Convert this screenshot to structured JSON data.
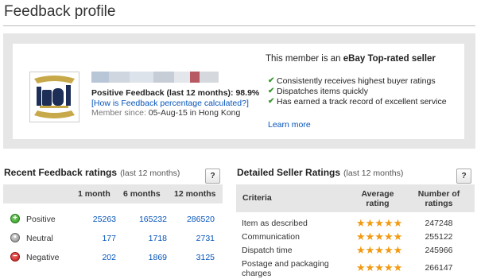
{
  "page": {
    "title": "Feedback profile"
  },
  "profile": {
    "positive_feedback": "Positive Feedback (last 12 months): 98.9%",
    "calc_link": "[How is Feedback percentage calculated?]",
    "member_since_label": "Member since:",
    "member_since_value": "05-Aug-15 in Hong Kong",
    "logo_icon": "no1-logo-icon"
  },
  "top_rated": {
    "prefix": "This member is an ",
    "highlight": "eBay Top-rated seller",
    "benefits": [
      "Consistently receives highest buyer ratings",
      "Dispatches items quickly",
      "Has earned a track record of excellent service"
    ],
    "learn_more": "Learn more",
    "check_color": "#3a9a2f"
  },
  "recent_feedback": {
    "title": "Recent Feedback ratings",
    "subtitle": "(last 12 months)",
    "help": "?",
    "columns": [
      "1 month",
      "6 months",
      "12 months"
    ],
    "rows": [
      {
        "label": "Positive",
        "icon": "positive-plus-icon",
        "values": [
          "25263",
          "165232",
          "286520"
        ]
      },
      {
        "label": "Neutral",
        "icon": "neutral-dot-icon",
        "values": [
          "177",
          "1718",
          "2731"
        ]
      },
      {
        "label": "Negative",
        "icon": "negative-minus-icon",
        "values": [
          "202",
          "1869",
          "3125"
        ]
      }
    ]
  },
  "detailed_ratings": {
    "title": "Detailed Seller Ratings",
    "subtitle": "(last 12 months)",
    "help": "?",
    "columns": [
      "Criteria",
      "Average rating",
      "Number of ratings"
    ],
    "rows": [
      {
        "criteria": "Item as described",
        "stars": 5,
        "count": "247248"
      },
      {
        "criteria": "Communication",
        "stars": 5,
        "count": "255122"
      },
      {
        "criteria": "Dispatch time",
        "stars": 5,
        "count": "245966"
      },
      {
        "criteria": "Postage and packaging charges",
        "stars": 5,
        "count": "266147"
      }
    ],
    "star_color": "#f29a12"
  }
}
